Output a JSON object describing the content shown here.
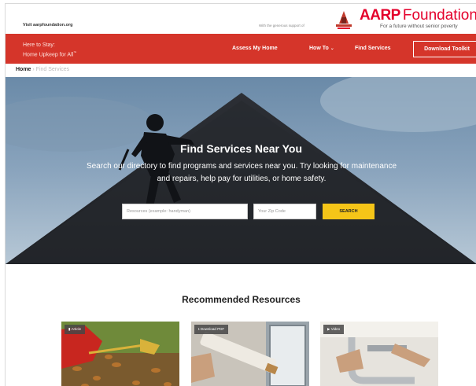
{
  "topbar": {
    "visit_link": "Visit aarpfoundation.org",
    "support_text": "With the generous support of",
    "aarp_word": "AARP",
    "foundation_word": "Foundation",
    "tagline": "For a future without senior poverty"
  },
  "navbar": {
    "program_line1": "Here to Stay:",
    "program_line2": "Home Upkeep for All",
    "assess": "Assess My Home",
    "howto": "How To",
    "find": "Find Services",
    "download": "Download Toolkit"
  },
  "breadcrumb": {
    "home": "Home",
    "separator": " › ",
    "current": "Find Services"
  },
  "hero": {
    "title": "Find Services Near You",
    "subtitle": "Search our directory to find programs and services near you. Try looking for maintenance and repairs, help pay for utilities, or home safety.",
    "resources_placeholder": "Resources (example: handyman)",
    "zip_placeholder": "Your Zip Code",
    "search_button": "SEARCH"
  },
  "recommended": {
    "title": "Recommended Resources",
    "cards": [
      {
        "badge": "Article",
        "icon": "document-icon"
      },
      {
        "badge": "Download PDF",
        "icon": "download-icon"
      },
      {
        "badge": "Video",
        "icon": "video-icon"
      }
    ]
  },
  "colors": {
    "brand_red": "#e4002b",
    "nav_red": "#d5352a",
    "search_yellow": "#f5c518"
  }
}
